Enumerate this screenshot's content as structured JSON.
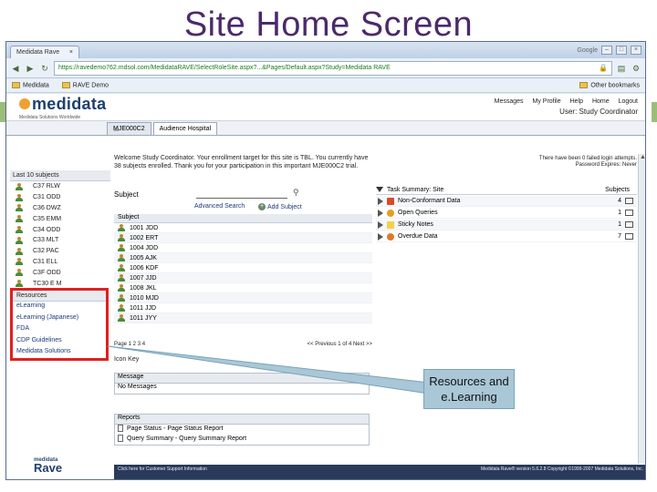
{
  "slide": {
    "title": "Site Home Screen"
  },
  "browser": {
    "tab_title": "Medidata Rave",
    "google_label": "Google",
    "url": "https://ravedemo762.mdsol.com/MedidataRAVE/SelectRoleSite.aspx?...&Pages/Default.aspx?Study=Medidata RAVE",
    "bookmarks": [
      "Medidata",
      "RAVE Demo"
    ],
    "other_bookmarks": "Other bookmarks"
  },
  "header": {
    "logo": "medidata",
    "tagline": "Medidata Solutions Worldwide",
    "links": [
      "Messages",
      "My Profile",
      "Help",
      "Home",
      "Logout"
    ],
    "user": "User: Study Coordinator"
  },
  "navtabs": [
    "MJE000C2",
    "Audience Hospital"
  ],
  "sidebar": {
    "last_subjects_label": "Last 10 subjects",
    "subjects": [
      "C37 RLW",
      "C31 ODD",
      "C36 DWZ",
      "C35 EMM",
      "C34 ODD",
      "C33 MLT",
      "C32 PAC",
      "C31 ELL",
      "C3F ODD",
      "TC30 E M"
    ],
    "resources_label": "Resources",
    "resources": [
      "eLearning",
      "eLearning (Japanese)",
      "FDA",
      "CDP Guidelines",
      "Medidata Solutions"
    ],
    "footer_small": "medidata",
    "footer_big": "Rave"
  },
  "main": {
    "welcome": "Welcome Study Coordinator. Your enrollment target for this site is TBL. You currently have 38 subjects enrolled. Thank you for your participation in this important MJE000C2 trial.",
    "subject_label": "Subject",
    "advanced_search": "Advanced Search",
    "add_subject": "Add Subject",
    "table_header": "Subject",
    "subjects": [
      "1001 JDD",
      "1002 ERT",
      "1004 JDD",
      "1005 AJK",
      "1006 KDF",
      "1007 JJD",
      "1008 JKL",
      "1010 MJD",
      "1011 JJD",
      "1011 JYY"
    ],
    "pager_left": "Page 1 2 3 4",
    "pager_right": "<< Previous 1 of 4 Next >>",
    "icon_key": "Icon Key",
    "messages_label": "Message",
    "no_messages": "No Messages",
    "reports_label": "Reports",
    "reports": [
      "Page Status - Page Status Report",
      "Query Summary - Query Summary Report"
    ]
  },
  "tasks": {
    "note": "There have been 0 failed login attempts. Password Expires: Never",
    "header": "Task Summary: Site",
    "subjects_col": "Subjects",
    "rows": [
      {
        "label": "Non-Conformant Data",
        "count": "4",
        "color": "#d64a2a"
      },
      {
        "label": "Open Queries",
        "count": "1",
        "color": "#e0a020"
      },
      {
        "label": "Sticky Notes",
        "count": "1",
        "color": "#f2d24a"
      },
      {
        "label": "Overdue Data",
        "count": "7",
        "color": "#e07a2a"
      }
    ]
  },
  "footer": {
    "left": "Click here for Customer Support Information",
    "right": "Medidata Rave® version 5.6.2.8  Copyright ©1999-2007 Medidata Solutions, Inc."
  },
  "callout": {
    "text": "Resources and e.Learning"
  }
}
